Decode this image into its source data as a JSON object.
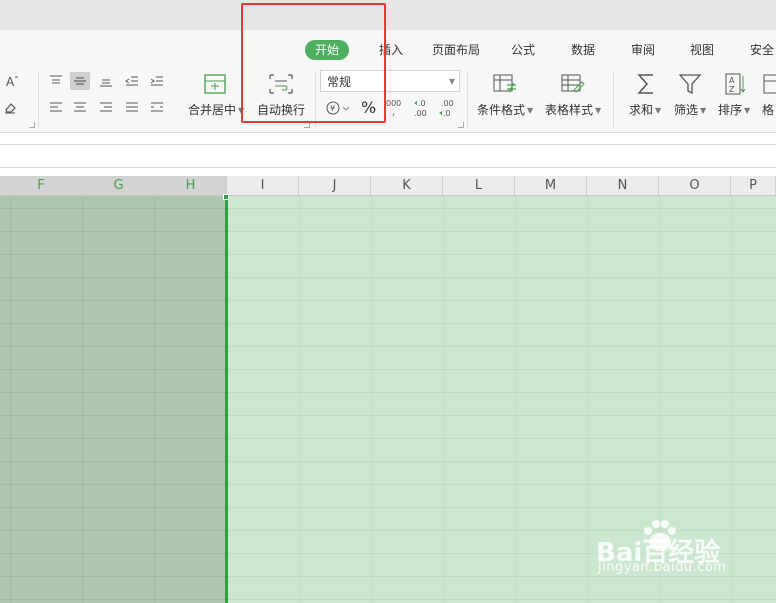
{
  "tabs": [
    {
      "label": "开始",
      "active": true
    },
    {
      "label": "插入"
    },
    {
      "label": "页面布局"
    },
    {
      "label": "公式"
    },
    {
      "label": "数据"
    },
    {
      "label": "审阅"
    },
    {
      "label": "视图"
    },
    {
      "label": "安全"
    }
  ],
  "ribbon": {
    "merge_label": "合并居中",
    "wrap_label": "自动换行",
    "number_format_value": "常规",
    "percent_symbol": "%",
    "thousands_symbol": "000",
    "currency_symbol": "¥",
    "conditional_format_label": "条件格式",
    "table_style_label": "表格样式",
    "sum_label": "求和",
    "filter_label": "筛选",
    "sort_label": "排序",
    "format_label_partial": "格"
  },
  "columns": [
    {
      "label": "F",
      "selected": true
    },
    {
      "label": "G",
      "selected": true
    },
    {
      "label": "H",
      "selected": true
    },
    {
      "label": "I",
      "selected": false
    },
    {
      "label": "J",
      "selected": false
    },
    {
      "label": "K",
      "selected": false
    },
    {
      "label": "L",
      "selected": false
    },
    {
      "label": "M",
      "selected": false
    },
    {
      "label": "N",
      "selected": false
    },
    {
      "label": "O",
      "selected": false
    },
    {
      "label": "P",
      "selected": false
    }
  ],
  "watermark": {
    "text": "Bai百经验",
    "sub": "jingyan.baidu.com"
  },
  "colors": {
    "accent": "#4daf5f",
    "selection_border": "#2fa03f",
    "annotation": "#e53935",
    "selected_fill": "#afc5ad",
    "sheet_fill": "#cce7d0"
  }
}
